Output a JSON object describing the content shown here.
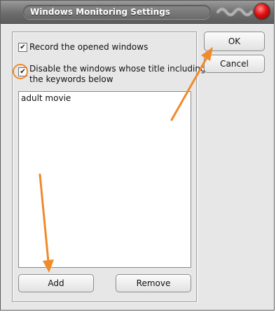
{
  "window": {
    "title": "Windows Monitoring Settings"
  },
  "options": {
    "record": {
      "label": "Record the opened windows",
      "checked": true
    },
    "disable": {
      "label_line1": "Disable the windows whose title including",
      "label_line2": "the keywords below",
      "checked": true
    }
  },
  "keywords": {
    "items": [
      "adult movie"
    ]
  },
  "buttons": {
    "ok": "OK",
    "cancel": "Cancel",
    "add": "Add",
    "remove": "Remove"
  },
  "annotations": {
    "arrow_color": "#f08a2a",
    "ring_color": "#f08a2a"
  },
  "icons": {
    "checkbox": "checkmark-icon",
    "close": "close-icon"
  }
}
